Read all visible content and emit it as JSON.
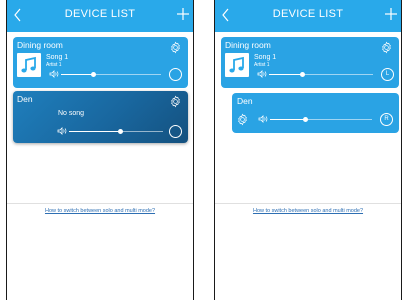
{
  "header": {
    "title": "DEVICE LIST"
  },
  "help_link": "How to switch between solo and multi mode?",
  "left_screen": {
    "device1": {
      "name": "Dining room",
      "song": "Song 1",
      "artist": "Artist 1",
      "volume": 0.32
    },
    "device2": {
      "name": "Den",
      "status": "No song",
      "volume": 0.55
    }
  },
  "right_screen": {
    "device1": {
      "name": "Dining room",
      "song": "Song 1",
      "artist": "Artist 1",
      "volume": 0.32,
      "channel": "L"
    },
    "device2": {
      "name": "Den",
      "volume": 0.35,
      "channel": "R"
    }
  },
  "colors": {
    "navbar": "#29a9ea",
    "card_active": "#2aa3e4",
    "card_selected": "#1b6ea9",
    "link": "#2e6fb3"
  }
}
